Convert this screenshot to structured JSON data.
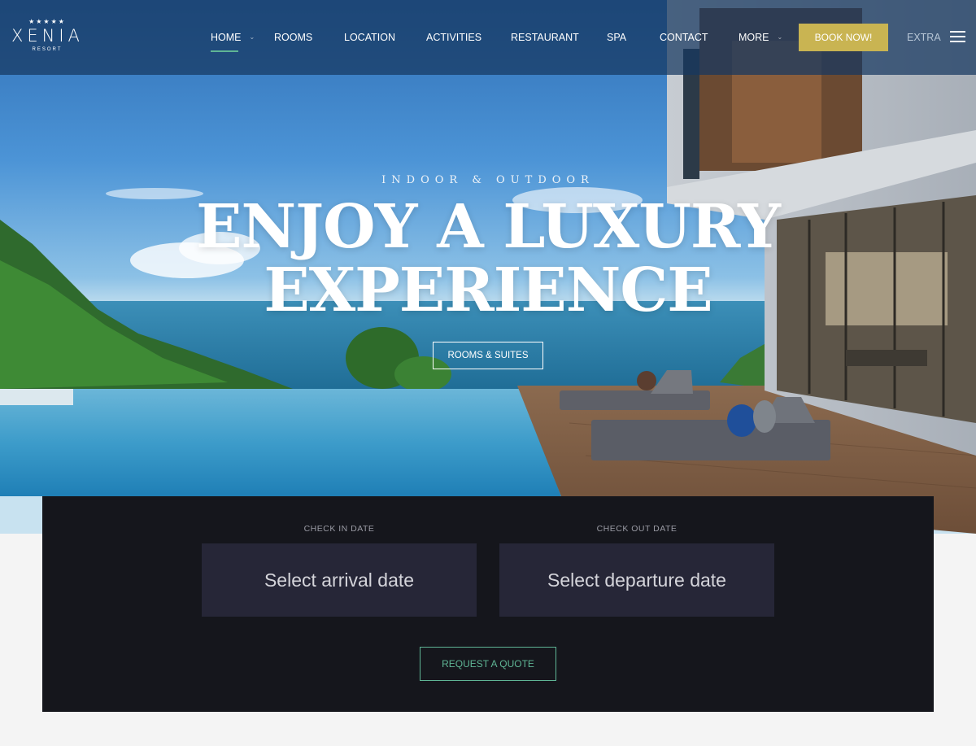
{
  "brand": {
    "stars": "★★★★★",
    "name": "XENIA",
    "tagline": "RESORT"
  },
  "nav": {
    "items": [
      {
        "label": "HOME",
        "active": true,
        "has_dropdown": true
      },
      {
        "label": "ROOMS"
      },
      {
        "label": "LOCATION"
      },
      {
        "label": "ACTIVITIES"
      },
      {
        "label": "RESTAURANT"
      },
      {
        "label": "SPA"
      },
      {
        "label": "CONTACT"
      },
      {
        "label": "MORE",
        "has_dropdown": true
      }
    ],
    "book_label": "BOOK NOW!",
    "extra_label": "EXTRA",
    "menu_icon": "hamburger-icon"
  },
  "hero": {
    "eyebrow": "INDOOR & OUTDOOR",
    "headline_line1": "ENJOY A LUXURY",
    "headline_line2": "EXPERIENCE",
    "cta_label": "ROOMS & SUITES"
  },
  "booking": {
    "check_in_label": "CHECK IN DATE",
    "check_in_placeholder": "Select arrival date",
    "check_out_label": "CHECK OUT DATE",
    "check_out_placeholder": "Select departure date",
    "quote_label": "REQUEST A QUOTE"
  },
  "colors": {
    "accent_gold": "#c9b452",
    "accent_green": "#5fb595",
    "booking_panel": "#15161c",
    "date_box": "#262637"
  }
}
